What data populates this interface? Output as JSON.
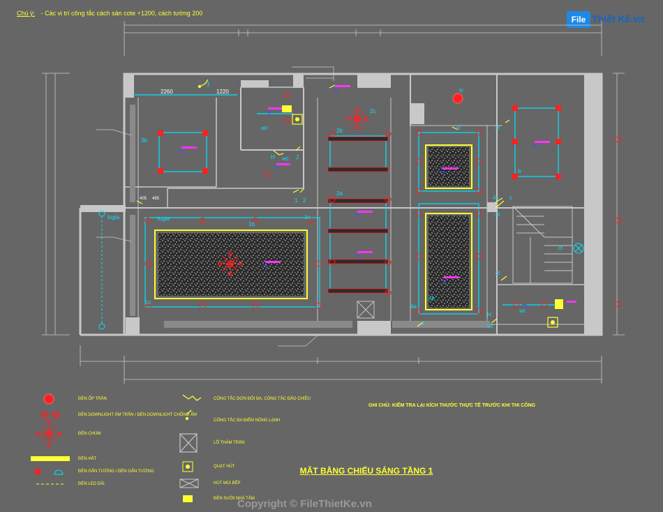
{
  "note": {
    "label": "Chú ý:",
    "text": "- Các vị trí công tắc cách sàn cote +1200, cách tường 200"
  },
  "logo": {
    "box": "File",
    "text": "Thiết Kế.vn"
  },
  "title": "MẶT BẰNG CHIẾU SÁNG TẦNG 1",
  "ghi_chu": "GHI CHÚ: KIỂM TRA LẠI KÍCH THƯỚC THỰC TẾ TRƯỚC KHI THI CÔNG",
  "watermark": "Copyright © FileThietKe.vn",
  "dims": {
    "d2260": "2260",
    "d1220": "1220",
    "d405": "405",
    "d495": "495"
  },
  "labels": {
    "wc1": "wc",
    "wc2": "wc",
    "wc3": "wc",
    "wc4": "wc",
    "loggia1": "logia",
    "loggia2": "logia",
    "l1a": "1a",
    "l1b": "1b",
    "l1c": "1c",
    "l2a": "2a",
    "l2b": "2b",
    "l2c": "2c",
    "l3b": "3b",
    "l3": "3",
    "l4a": "4a",
    "l4b": "4b",
    "l4c": "4c",
    "lb": "b",
    "lc": "c",
    "liv1": "iv",
    "liv2": "iv",
    "lH1": "H",
    "lH2": "H",
    "lH3": "H",
    "lct1": "ct",
    "lct2": "ct",
    "lct3": "ct",
    "lJ": "J",
    "l1": "1",
    "l2": "2",
    "l4": "4"
  },
  "legend": {
    "l1": "ĐÈN ỐP TRẦN",
    "l2": "ĐÈN DOWNLIGHT ÂM TRẦN / ĐÈN DOWNLIGHT CHỐNG ẨM",
    "l3": "ĐÈN CHÙM",
    "l4": "ĐÈN HẮT",
    "l5": "ĐÈN GẮN TƯỜNG / ĐÈN GẮN TƯỜNG",
    "l6": "ĐÈN LED DẢI",
    "r1": "CÔNG TẮC ĐƠN ĐÔI BA, CÔNG TẮC ĐẢO CHIỀU",
    "r2": "CÔNG TẮC ĐA ĐIỂM NÓNG LẠNH",
    "r3": "LỖ THĂM TRẦN",
    "r4": "QUẠT HÚT",
    "r5": "HÚT MÙI BẾP",
    "r6": "ĐÈN SƯỞI NHÀ TẮM"
  },
  "colors": {
    "bg": "#666666",
    "wall": "#c8c8c8",
    "cyan": "#00e5ff",
    "red": "#ff2020",
    "yellow": "#ffff33",
    "magenta": "#ff33ff",
    "blue": "#3355ff"
  }
}
